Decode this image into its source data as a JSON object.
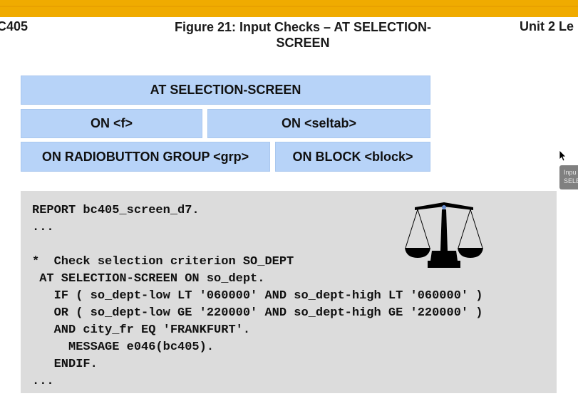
{
  "header": {
    "left": "C405",
    "title": "Figure 21: Input Checks – AT SELECTION-SCREEN",
    "right": "Unit 2 Le"
  },
  "diagram": {
    "top_box": "AT SELECTION-SCREEN",
    "row1": [
      "ON <f>",
      "ON <seltab>"
    ],
    "row2": [
      "ON RADIOBUTTON GROUP <grp>",
      "ON BLOCK <block>"
    ]
  },
  "code_lines": [
    "REPORT bc405_screen_d7.",
    "...",
    "",
    "*  Check selection criterion SO_DEPT",
    " AT SELECTION-SCREEN ON so_dept.",
    "   IF ( so_dept-low LT '060000' AND so_dept-high LT '060000' )",
    "   OR ( so_dept-low GE '220000' AND so_dept-high GE '220000' )",
    "   AND city_fr EQ 'FRANKFURT'.",
    "     MESSAGE e046(bc405).",
    "   ENDIF.",
    "..."
  ],
  "tooltip": {
    "line1": "Inpu",
    "line2": "SELE"
  },
  "colors": {
    "top_bar": "#f0ab00",
    "box_fill": "#b7d3f8",
    "code_panel": "#dcdcdc"
  },
  "icons": [
    "scales-of-justice-icon",
    "mouse-cursor-icon"
  ]
}
